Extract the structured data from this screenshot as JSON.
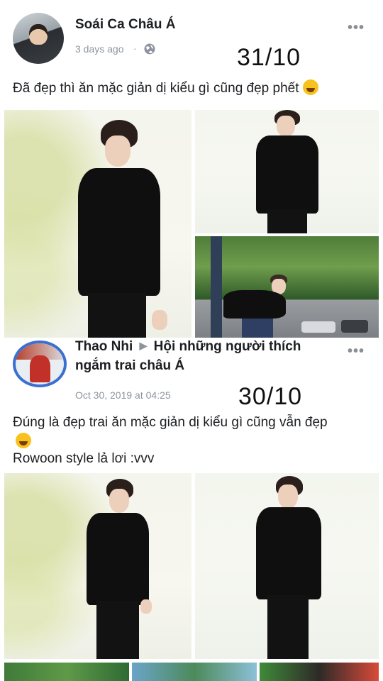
{
  "post1": {
    "author_name": "Soái Ca Châu Á",
    "time_ago": "3 days ago",
    "privacy_icon": "globe-icon",
    "more_label": "•••",
    "handwritten_date": "31/10",
    "caption": "Đã đẹp thì ăn mặc giản dị kiểu gì cũng đẹp phết",
    "emoji": "star-struck-emoji"
  },
  "post2": {
    "author_name": "Thao Nhi",
    "arrow": "▶",
    "group_name_line1": "Hội những người thích",
    "group_name_line2": "ngắm trai châu Á",
    "timestamp": "Oct 30, 2019 at 04:25",
    "more_label": "•••",
    "handwritten_date": "30/10",
    "caption_line1": "Đúng là đẹp trai ăn mặc giản dị kiểu gì cũng vẫn đẹp",
    "emoji": "laughing-emoji",
    "caption_line2": "Rowoon style lả lơi :vvv"
  },
  "colors": {
    "background": "#ffffff",
    "meta_text": "#8d949e",
    "avatar_ring": "#3b6fd1",
    "shirt": "#0f0f10"
  }
}
